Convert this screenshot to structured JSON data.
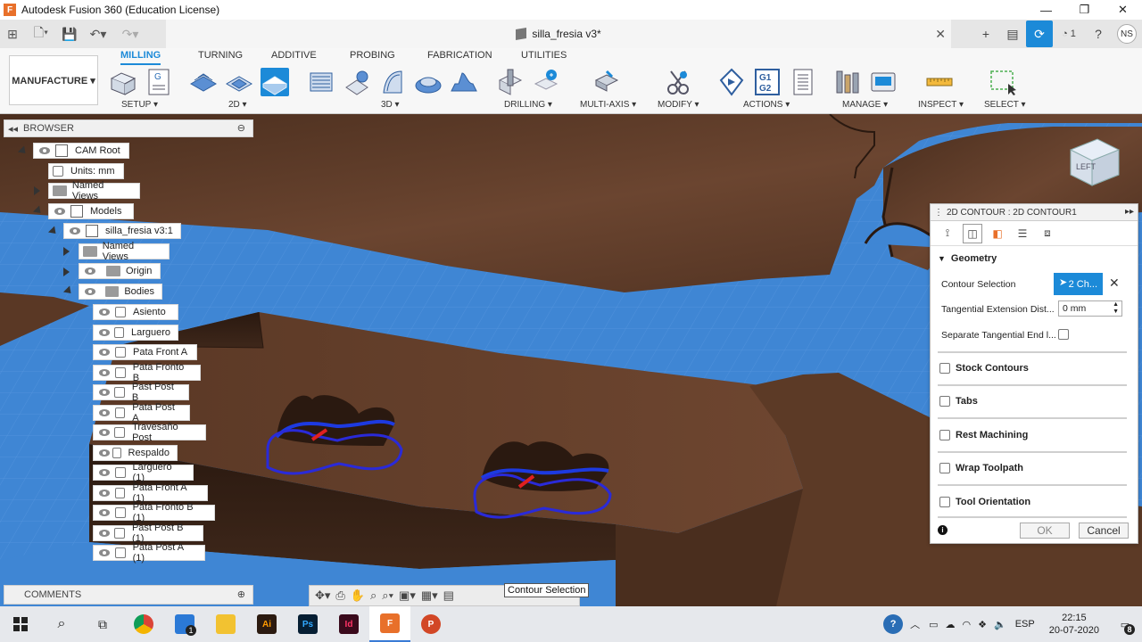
{
  "window": {
    "title": "Autodesk Fusion 360 (Education License)",
    "app_icon_letter": "F",
    "minimize": "—",
    "maximize": "❐",
    "close": "✕"
  },
  "quick_access": {
    "document_title": "silla_fresia v3*",
    "doc_close": "✕",
    "job_count": "1",
    "user_initials": "NS"
  },
  "ribbon": {
    "workspace": "MANUFACTURE ▾",
    "tabs": [
      {
        "label": "MILLING",
        "active": true
      },
      {
        "label": "TURNING",
        "active": false
      },
      {
        "label": "ADDITIVE",
        "active": false
      },
      {
        "label": "PROBING",
        "active": false
      },
      {
        "label": "FABRICATION",
        "active": false
      },
      {
        "label": "UTILITIES",
        "active": false
      }
    ],
    "groups": [
      "SETUP ▾",
      "2D ▾",
      "3D ▾",
      "DRILLING ▾",
      "MULTI-AXIS ▾",
      "MODIFY ▾",
      "ACTIONS ▾",
      "MANAGE ▾",
      "INSPECT ▾",
      "SELECT ▾"
    ],
    "g1g2_label": "G1\nG2"
  },
  "browser": {
    "header": "BROWSER",
    "items": [
      {
        "label": "CAM Root"
      },
      {
        "label": "Units: mm"
      },
      {
        "label": "Named Views"
      },
      {
        "label": "Models"
      },
      {
        "label": "silla_fresia v3:1"
      },
      {
        "label": "Named Views"
      },
      {
        "label": "Origin"
      },
      {
        "label": "Bodies"
      }
    ],
    "bodies": [
      "Asiento",
      "Larguero",
      "Pata Front A",
      "Pata Fronto B",
      "Past Post B",
      "Pata Post A",
      "Travesaño Post",
      "Respaldo",
      "Larguero (1)",
      "Pata Front A (1)",
      "Pata Fronto B (1)",
      "Past Post B (1)",
      "Pata Post A (1)"
    ]
  },
  "comments": {
    "label": "COMMENTS"
  },
  "tooltip": "Contour Selection",
  "viewcube": {
    "face": "LEFT"
  },
  "dialog": {
    "title": "2D CONTOUR : 2D CONTOUR1",
    "geometry_label": "Geometry",
    "contour_selection_label": "Contour Selection",
    "contour_selection_value": "2 Ch...",
    "tangential_label": "Tangential Extension Dist...",
    "tangential_value": "0 mm",
    "separate_label": "Separate Tangential End l...",
    "sections": [
      "Stock Contours",
      "Tabs",
      "Rest Machining",
      "Wrap Toolpath",
      "Tool Orientation"
    ],
    "ok": "OK",
    "cancel": "Cancel"
  },
  "taskbar": {
    "apps": [
      {
        "name": "chrome",
        "letter": "",
        "color": "#db4437"
      },
      {
        "name": "mail",
        "letter": "",
        "color": "#2b79d6"
      },
      {
        "name": "explorer",
        "letter": "",
        "color": "#f2c231"
      },
      {
        "name": "illustrator",
        "letter": "Ai",
        "color": "#ff9a00"
      },
      {
        "name": "photoshop",
        "letter": "Ps",
        "color": "#31a8ff"
      },
      {
        "name": "indesign",
        "letter": "Id",
        "color": "#ff3366"
      },
      {
        "name": "fusion",
        "letter": "F",
        "color": "#e8702a"
      },
      {
        "name": "powerpoint",
        "letter": "P",
        "color": "#d24726"
      }
    ],
    "mail_badge": "1",
    "language": "ESP",
    "time": "22:15",
    "date": "20-07-2020",
    "notifications": "8"
  },
  "colors": {
    "accent": "#1c8ad8",
    "wood_dark": "#3b2519",
    "wood_mid": "#5a3825",
    "stock_blue": "#3f86d4"
  }
}
